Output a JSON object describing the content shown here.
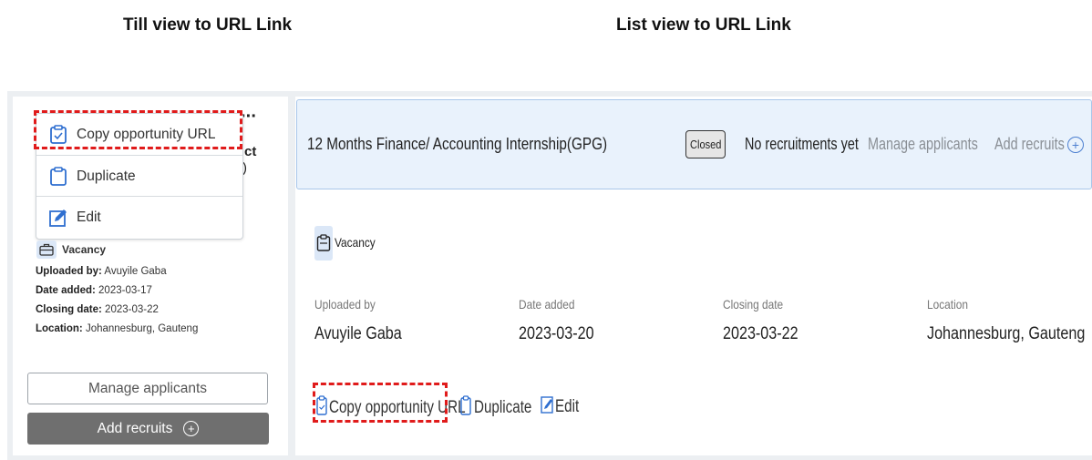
{
  "headings": {
    "tile_view": "Till view to URL Link",
    "list_view": "List view to URL Link"
  },
  "tile": {
    "more_icon": "more-horizontal-icon",
    "clipped_title_fragment_1": "ct",
    "clipped_title_fragment_2": ")",
    "menu": {
      "copy_url": "Copy opportunity URL",
      "duplicate": "Duplicate",
      "edit": "Edit"
    },
    "type_label": "Vacancy",
    "meta": {
      "uploaded_by_label": "Uploaded by:",
      "uploaded_by_value": "Avuyile Gaba",
      "date_added_label": "Date added:",
      "date_added_value": "2023-03-17",
      "closing_date_label": "Closing date:",
      "closing_date_value": "2023-03-22",
      "location_label": "Location:",
      "location_value": "Johannesburg, Gauteng"
    },
    "manage_button": "Manage applicants",
    "add_button": "Add recruits",
    "add_icon": "⊕"
  },
  "list": {
    "title": "12 Months Finance/ Accounting Internship(GPG)",
    "status_badge": "Closed",
    "recruit_status": "No recruitments yet",
    "manage_link": "Manage applicants",
    "add_link": "Add recruits",
    "add_icon": "+",
    "type_label": "Vacancy",
    "fields": [
      {
        "label": "Uploaded by",
        "value": "Avuyile Gaba"
      },
      {
        "label": "Date added",
        "value": "2023-03-20"
      },
      {
        "label": "Closing date",
        "value": "2023-03-22"
      },
      {
        "label": "Location",
        "value": "Johannesburg, Gauteng"
      }
    ],
    "actions": {
      "copy_url": "Copy opportunity URL",
      "duplicate": "Duplicate",
      "edit": "Edit"
    }
  },
  "colors": {
    "highlight_dash": "#e01b1b",
    "list_header_bg": "#e9f2fc",
    "add_button_bg": "#6f6f6f",
    "icon_blue": "#2f6fd0"
  }
}
